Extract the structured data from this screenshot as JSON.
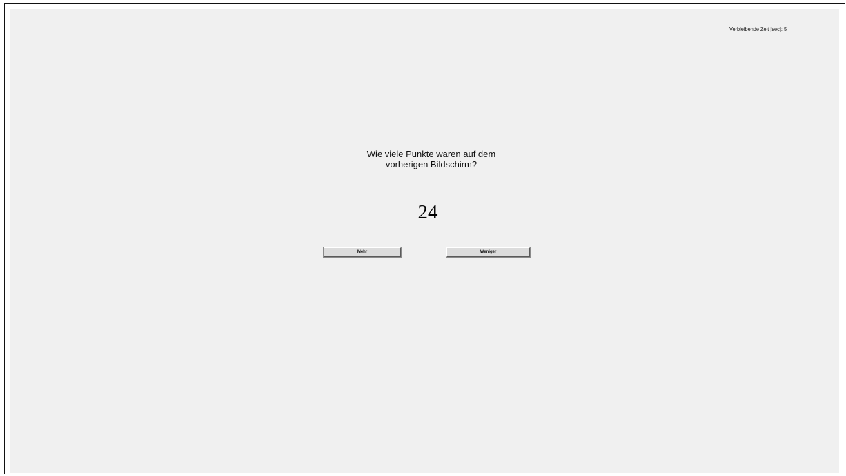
{
  "timer": {
    "text": "Verbleibende Zeit [sec]: 5"
  },
  "question": {
    "line1": "Wie viele Punkte waren auf dem",
    "line2": "vorherigen Bildschirm?"
  },
  "count": {
    "value": "24"
  },
  "buttons": {
    "more_label": "Mehr",
    "less_label": "Weniger"
  },
  "colors": {
    "panel_background": "#f0f0f0",
    "button_face": "#dcdcdc"
  }
}
